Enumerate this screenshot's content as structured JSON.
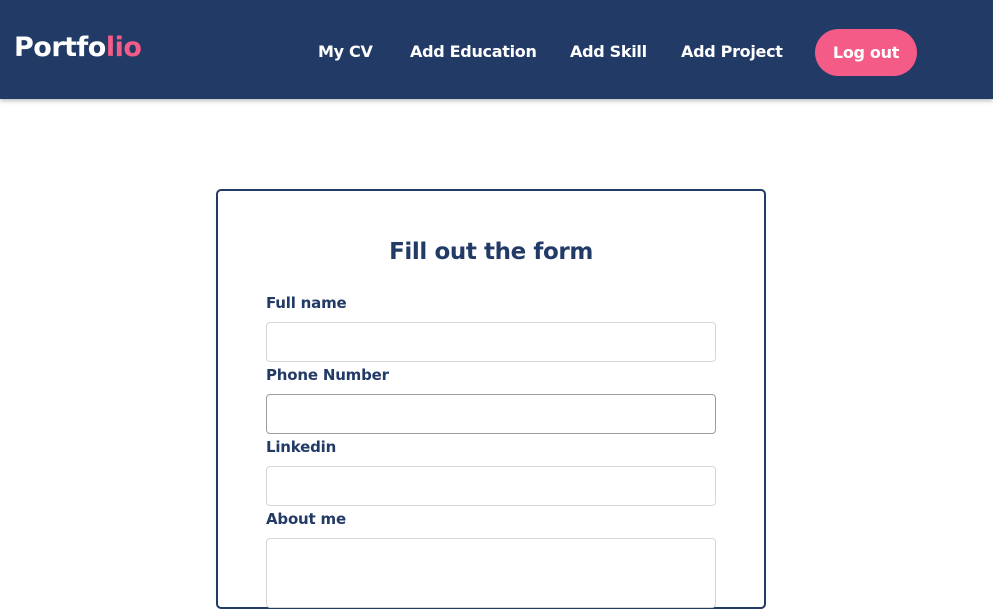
{
  "navbar": {
    "logo_main": "Portfo",
    "logo_accent": "lio",
    "links": [
      {
        "label": "My CV"
      },
      {
        "label": "Add Education"
      },
      {
        "label": "Add Skill"
      },
      {
        "label": "Add Project"
      }
    ],
    "logout_label": "Log out"
  },
  "form": {
    "title": "Fill out the form",
    "fields": [
      {
        "label": "Full name",
        "value": "",
        "placeholder": ""
      },
      {
        "label": "Phone Number",
        "value": "",
        "placeholder": ""
      },
      {
        "label": "Linkedin",
        "value": "",
        "placeholder": ""
      },
      {
        "label": "About me",
        "value": "",
        "placeholder": ""
      }
    ]
  },
  "colors": {
    "navbar_bg": "#223a66",
    "accent": "#f45b86",
    "text_dark": "#223a66"
  }
}
